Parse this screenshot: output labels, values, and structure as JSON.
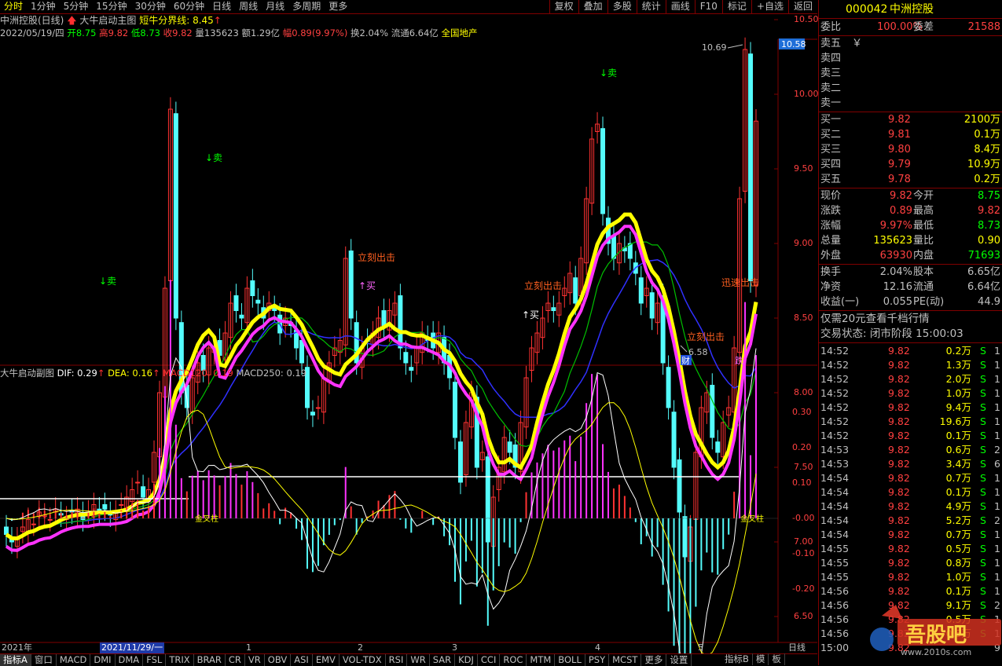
{
  "top_bar": {
    "periods": [
      "分时",
      "1分钟",
      "5分钟",
      "15分钟",
      "30分钟",
      "60分钟",
      "日线",
      "周线",
      "月线",
      "多周期",
      "更多"
    ],
    "active_period": "分时",
    "tools": [
      "复权",
      "叠加",
      "多股",
      "统计",
      "画线",
      "F10",
      "标记",
      "+自选",
      "返回"
    ]
  },
  "title": {
    "stock_name": "中洲控股(日线)",
    "indicator_name": "大牛启动主图",
    "bull_line_label": "短牛分界线: 8.45"
  },
  "quote_line": {
    "date": "2022/05/19/四",
    "open": "开8.75",
    "high": "高9.82",
    "low": "低8.73",
    "close": "收9.82",
    "volume": "量135623",
    "amount": "额1.29亿",
    "change": "幅0.89(9.97%)",
    "turnover": "换2.04%",
    "float": "流通6.64亿",
    "sector": "全国地产"
  },
  "main_axis": {
    "labels": [
      "10.50",
      "10.00",
      "9.50",
      "9.00",
      "8.50",
      "8.00",
      "7.50",
      "7.00",
      "6.50"
    ],
    "current_price_tag": "10.58",
    "annotations": {
      "high_mark": "10.69",
      "low_mark": "6.58"
    }
  },
  "signals": {
    "sell": "↓卖",
    "buy": "↑买",
    "exit": "立刻出击",
    "exit2": "迅速出击",
    "cai": "财",
    "die": "跌"
  },
  "sub_chart": {
    "title": "大牛启动副图",
    "dif": "DIF: 0.29",
    "dea": "DEA: 0.16",
    "macd120": "MACD120: 0.19",
    "macd250": "MACD250: 0.19",
    "axis_labels": [
      "0.30",
      "0.20",
      "0.10",
      "-0.00",
      "-0.10",
      "-0.20"
    ],
    "gold_label": "金叉柱"
  },
  "x_axis": {
    "labels": [
      "2021年",
      "2021/11/29/一",
      "1",
      "2",
      "3",
      "4",
      "5"
    ],
    "period_label": "日线"
  },
  "bottom_tabs": [
    "指标A",
    "窗口",
    "MACD",
    "DMI",
    "DMA",
    "FSL",
    "TRIX",
    "BRAR",
    "CR",
    "VR",
    "OBV",
    "ASI",
    "EMV",
    "VOL-TDX",
    "RSI",
    "WR",
    "SAR",
    "KDJ",
    "CCI",
    "ROC",
    "MTM",
    "BOLL",
    "PSY",
    "MCST",
    "更多",
    "设置"
  ],
  "bottom_right_tabs": [
    "指标B",
    "模",
    "板"
  ],
  "right_panel": {
    "code": "000042",
    "name": "中洲控股",
    "weibi_label": "委比",
    "weibi": "100.00%",
    "weicha_label": "委差",
    "weicha": "21588",
    "sell_levels": [
      {
        "label": "卖五",
        "price": "￥",
        "vol": ""
      },
      {
        "label": "卖四",
        "price": "",
        "vol": ""
      },
      {
        "label": "卖三",
        "price": "",
        "vol": ""
      },
      {
        "label": "卖二",
        "price": "",
        "vol": ""
      },
      {
        "label": "卖一",
        "price": "",
        "vol": ""
      }
    ],
    "buy_levels": [
      {
        "label": "买一",
        "price": "9.82",
        "vol": "2100万"
      },
      {
        "label": "买二",
        "price": "9.81",
        "vol": "0.1万"
      },
      {
        "label": "买三",
        "price": "9.80",
        "vol": "8.4万"
      },
      {
        "label": "买四",
        "price": "9.79",
        "vol": "10.9万"
      },
      {
        "label": "买五",
        "price": "9.78",
        "vol": "0.2万"
      }
    ],
    "stats": [
      {
        "l1": "现价",
        "v1": "9.82",
        "l2": "今开",
        "v2": "8.75",
        "c1": "#ff4040",
        "c2": "#00ff00"
      },
      {
        "l1": "涨跌",
        "v1": "0.89",
        "l2": "最高",
        "v2": "9.82",
        "c1": "#ff4040",
        "c2": "#ff4040"
      },
      {
        "l1": "涨幅",
        "v1": "9.97%",
        "l2": "最低",
        "v2": "8.73",
        "c1": "#ff4040",
        "c2": "#00ff00"
      },
      {
        "l1": "总量",
        "v1": "135623",
        "l2": "量比",
        "v2": "0.90",
        "c1": "#ffff00",
        "c2": "#ffff00"
      },
      {
        "l1": "外盘",
        "v1": "63930",
        "l2": "内盘",
        "v2": "71693",
        "c1": "#ff4040",
        "c2": "#00ff00"
      }
    ],
    "stats2": [
      {
        "l1": "换手",
        "v1": "2.04%",
        "l2": "股本",
        "v2": "6.65亿"
      },
      {
        "l1": "净资",
        "v1": "12.16",
        "l2": "流通",
        "v2": "6.64亿"
      },
      {
        "l1": "收益(一)",
        "v1": "0.055",
        "l2": "PE(动)",
        "v2": "44.9"
      }
    ],
    "promo": "仅需20元查看千档行情",
    "trade_status": "交易状态: 闭市阶段 15:00:03",
    "ticks": [
      {
        "t": "14:52",
        "p": "9.82",
        "v": "0.2万",
        "s": "S",
        "n": "1"
      },
      {
        "t": "14:52",
        "p": "9.82",
        "v": "1.3万",
        "s": "S",
        "n": "1"
      },
      {
        "t": "14:52",
        "p": "9.82",
        "v": "2.0万",
        "s": "S",
        "n": "1"
      },
      {
        "t": "14:52",
        "p": "9.82",
        "v": "1.0万",
        "s": "S",
        "n": "1"
      },
      {
        "t": "14:52",
        "p": "9.82",
        "v": "9.4万",
        "s": "S",
        "n": "1"
      },
      {
        "t": "14:52",
        "p": "9.82",
        "v": "19.6万",
        "s": "S",
        "n": "1"
      },
      {
        "t": "14:52",
        "p": "9.82",
        "v": "0.1万",
        "s": "S",
        "n": "1"
      },
      {
        "t": "14:53",
        "p": "9.82",
        "v": "0.6万",
        "s": "S",
        "n": "2"
      },
      {
        "t": "14:53",
        "p": "9.82",
        "v": "3.4万",
        "s": "S",
        "n": "6"
      },
      {
        "t": "14:54",
        "p": "9.82",
        "v": "0.7万",
        "s": "S",
        "n": "1"
      },
      {
        "t": "14:54",
        "p": "9.82",
        "v": "0.1万",
        "s": "S",
        "n": "1"
      },
      {
        "t": "14:54",
        "p": "9.82",
        "v": "4.9万",
        "s": "S",
        "n": "1"
      },
      {
        "t": "14:54",
        "p": "9.82",
        "v": "5.2万",
        "s": "S",
        "n": "2"
      },
      {
        "t": "14:54",
        "p": "9.82",
        "v": "0.7万",
        "s": "S",
        "n": "1"
      },
      {
        "t": "14:55",
        "p": "9.82",
        "v": "0.5万",
        "s": "S",
        "n": "1"
      },
      {
        "t": "14:55",
        "p": "9.82",
        "v": "0.8万",
        "s": "S",
        "n": "1"
      },
      {
        "t": "14:55",
        "p": "9.82",
        "v": "1.0万",
        "s": "S",
        "n": "1"
      },
      {
        "t": "14:56",
        "p": "9.82",
        "v": "0.1万",
        "s": "S",
        "n": "1"
      },
      {
        "t": "14:56",
        "p": "9.82",
        "v": "9.1万",
        "s": "S",
        "n": "2"
      },
      {
        "t": "14:56",
        "p": "9.82",
        "v": "0.5万",
        "s": "S",
        "n": "1"
      },
      {
        "t": "14:56",
        "p": "9.82",
        "v": "0.5万",
        "s": "S",
        "n": "1"
      },
      {
        "t": "15:00",
        "p": "9.82",
        "v": "",
        "s": "",
        "n": "9"
      }
    ],
    "watermark": "www.2010s.com"
  },
  "colors": {
    "up": "#ff3232",
    "down": "#54fcfc",
    "yellow": "#ffff00",
    "magenta": "#ff33ff",
    "blue": "#3030ff",
    "green": "#00c000",
    "frame": "#800000"
  }
}
